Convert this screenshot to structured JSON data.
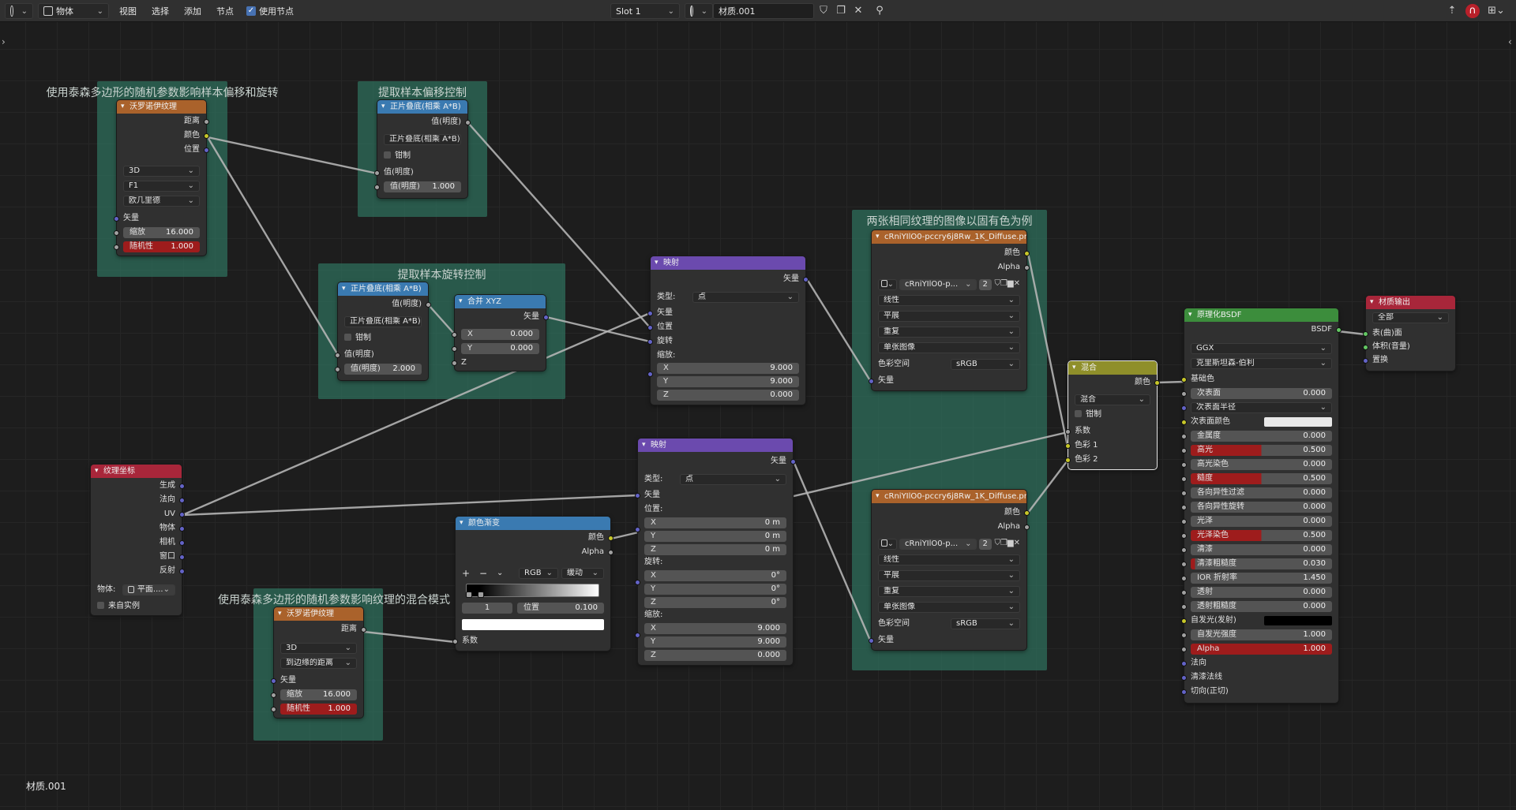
{
  "header": {
    "editor_type": "节点编辑器",
    "object_mode": "物体",
    "menu": [
      "视图",
      "选择",
      "添加",
      "节点"
    ],
    "use_nodes_label": "使用节点",
    "slot": "Slot 1",
    "material_name": "材质.001"
  },
  "frames": {
    "f1": "使用泰森多边形的随机参数影响样本偏移和旋转",
    "f2": "提取样本偏移控制",
    "f3": "提取样本旋转控制",
    "f4": "两张相同纹理的图像以固有色为例",
    "f5": "使用泰森多边形的随机参数影响纹理的混合模式"
  },
  "voronoi1": {
    "title": "沃罗诺伊纹理",
    "out": [
      "距离",
      "颜色",
      "位置"
    ],
    "dim": "3D",
    "feature": "F1",
    "metric": "欧几里德",
    "vector": "矢量",
    "scale_label": "缩放",
    "scale": "16.000",
    "rand_label": "随机性",
    "rand": "1.000"
  },
  "mul1": {
    "title": "正片叠底(相乘 A*B)",
    "out": "值(明度)",
    "op": "正片叠底(相乘 A*B)",
    "clamp": "钳制",
    "in1": "值(明度)",
    "in2_label": "值(明度)",
    "in2": "1.000"
  },
  "mul2": {
    "title": "正片叠底(相乘 A*B)",
    "out": "值(明度)",
    "op": "正片叠底(相乘 A*B)",
    "clamp": "钳制",
    "in1": "值(明度)",
    "in2_label": "值(明度)",
    "in2": "2.000"
  },
  "combine": {
    "title": "合并 XYZ",
    "out": "矢量",
    "x": "X",
    "xv": "0.000",
    "y": "Y",
    "yv": "0.000",
    "z": "Z"
  },
  "mapping1": {
    "title": "映射",
    "out": "矢量",
    "type_label": "类型:",
    "type": "点",
    "vec": "矢量",
    "loc": "位置",
    "rot": "旋转",
    "scale": "缩放:",
    "sx": "9.000",
    "sy": "9.000",
    "sz": "0.000"
  },
  "image1": {
    "title": "cRniYIlO0-pccry6j8Rw_1K_Diffuse.pn",
    "out_color": "颜色",
    "out_alpha": "Alpha",
    "img": "cRniYIlO0-p...",
    "users": "2",
    "interp": "线性",
    "proj": "平展",
    "ext": "重复",
    "src": "单张图像",
    "cs_label": "色彩空间",
    "cs": "sRGB",
    "vec": "矢量"
  },
  "image2": {
    "title": "cRniYIlO0-pccry6j8Rw_1K_Diffuse.pn",
    "out_color": "颜色",
    "out_alpha": "Alpha",
    "img": "cRniYIlO0-p...",
    "users": "2",
    "interp": "线性",
    "proj": "平展",
    "ext": "重复",
    "src": "单张图像",
    "cs_label": "色彩空间",
    "cs": "sRGB",
    "vec": "矢量"
  },
  "mix": {
    "title": "混合",
    "out": "颜色",
    "mode": "混合",
    "clamp": "钳制",
    "fac": "系数",
    "c1": "色彩 1",
    "c2": "色彩 2"
  },
  "bsdf": {
    "title": "原理化BSDF",
    "out": "BSDF",
    "dist": "GGX",
    "sss_method": "克里斯坦森-伯利",
    "rows": [
      {
        "label": "基础色",
        "kind": "sock"
      },
      {
        "label": "次表面",
        "value": "0.000"
      },
      {
        "label": "次表面半径",
        "kind": "dd"
      },
      {
        "label": "次表面颜色",
        "kind": "color",
        "color": "#e8e8e8"
      },
      {
        "label": "金属度",
        "value": "0.000"
      },
      {
        "label": "高光",
        "value": "0.500",
        "fill": 0.5
      },
      {
        "label": "高光染色",
        "value": "0.000"
      },
      {
        "label": "糙度",
        "value": "0.500",
        "fill": 0.5
      },
      {
        "label": "各向异性过滤",
        "value": "0.000"
      },
      {
        "label": "各向异性旋转",
        "value": "0.000"
      },
      {
        "label": "光泽",
        "value": "0.000"
      },
      {
        "label": "光泽染色",
        "value": "0.500",
        "fill": 0.5
      },
      {
        "label": "清漆",
        "value": "0.000"
      },
      {
        "label": "清漆粗糙度",
        "value": "0.030",
        "fill": 0.03
      },
      {
        "label": "IOR 折射率",
        "value": "1.450"
      },
      {
        "label": "透射",
        "value": "0.000"
      },
      {
        "label": "透射粗糙度",
        "value": "0.000"
      },
      {
        "label": "自发光(发射)",
        "kind": "color",
        "color": "#000000"
      },
      {
        "label": "自发光强度",
        "value": "1.000"
      },
      {
        "label": "Alpha",
        "value": "1.000",
        "fill": 1.0
      },
      {
        "label": "法向",
        "kind": "sock"
      },
      {
        "label": "清漆法线",
        "kind": "sock"
      },
      {
        "label": "切向(正切)",
        "kind": "sock"
      }
    ]
  },
  "output": {
    "title": "材质输出",
    "target": "全部",
    "in": [
      "表(曲)面",
      "体积(音量)",
      "置换"
    ]
  },
  "texcoord": {
    "title": "纹理坐标",
    "out": [
      "生成",
      "法向",
      "UV",
      "物体",
      "相机",
      "窗口",
      "反射"
    ],
    "obj_label": "物体:",
    "obj": "平面....",
    "from_inst": "来自实例"
  },
  "mapping2": {
    "title": "映射",
    "out": "矢量",
    "type_label": "类型:",
    "type": "点",
    "vec": "矢量",
    "loc": "位置:",
    "rot": "旋转:",
    "scale": "缩放:",
    "lx": "0 m",
    "ly": "0 m",
    "lz": "0 m",
    "rx": "0°",
    "ry": "0°",
    "rz": "0°",
    "sx": "9.000",
    "sy": "9.000",
    "sz": "0.000"
  },
  "ramp": {
    "title": "颜色渐变",
    "out_color": "颜色",
    "out_alpha": "Alpha",
    "plus": "+",
    "minus": "−",
    "mode": "RGB",
    "interp": "缓动",
    "idx": "1",
    "pos_label": "位置",
    "pos": "0.100",
    "fac": "系数"
  },
  "voronoi2": {
    "title": "沃罗诺伊纹理",
    "out": "距离",
    "dim": "3D",
    "feature": "到边缘的距离",
    "vector": "矢量",
    "scale_label": "缩放",
    "scale": "16.000",
    "rand_label": "随机性",
    "rand": "1.000"
  },
  "footer": "材质.001"
}
